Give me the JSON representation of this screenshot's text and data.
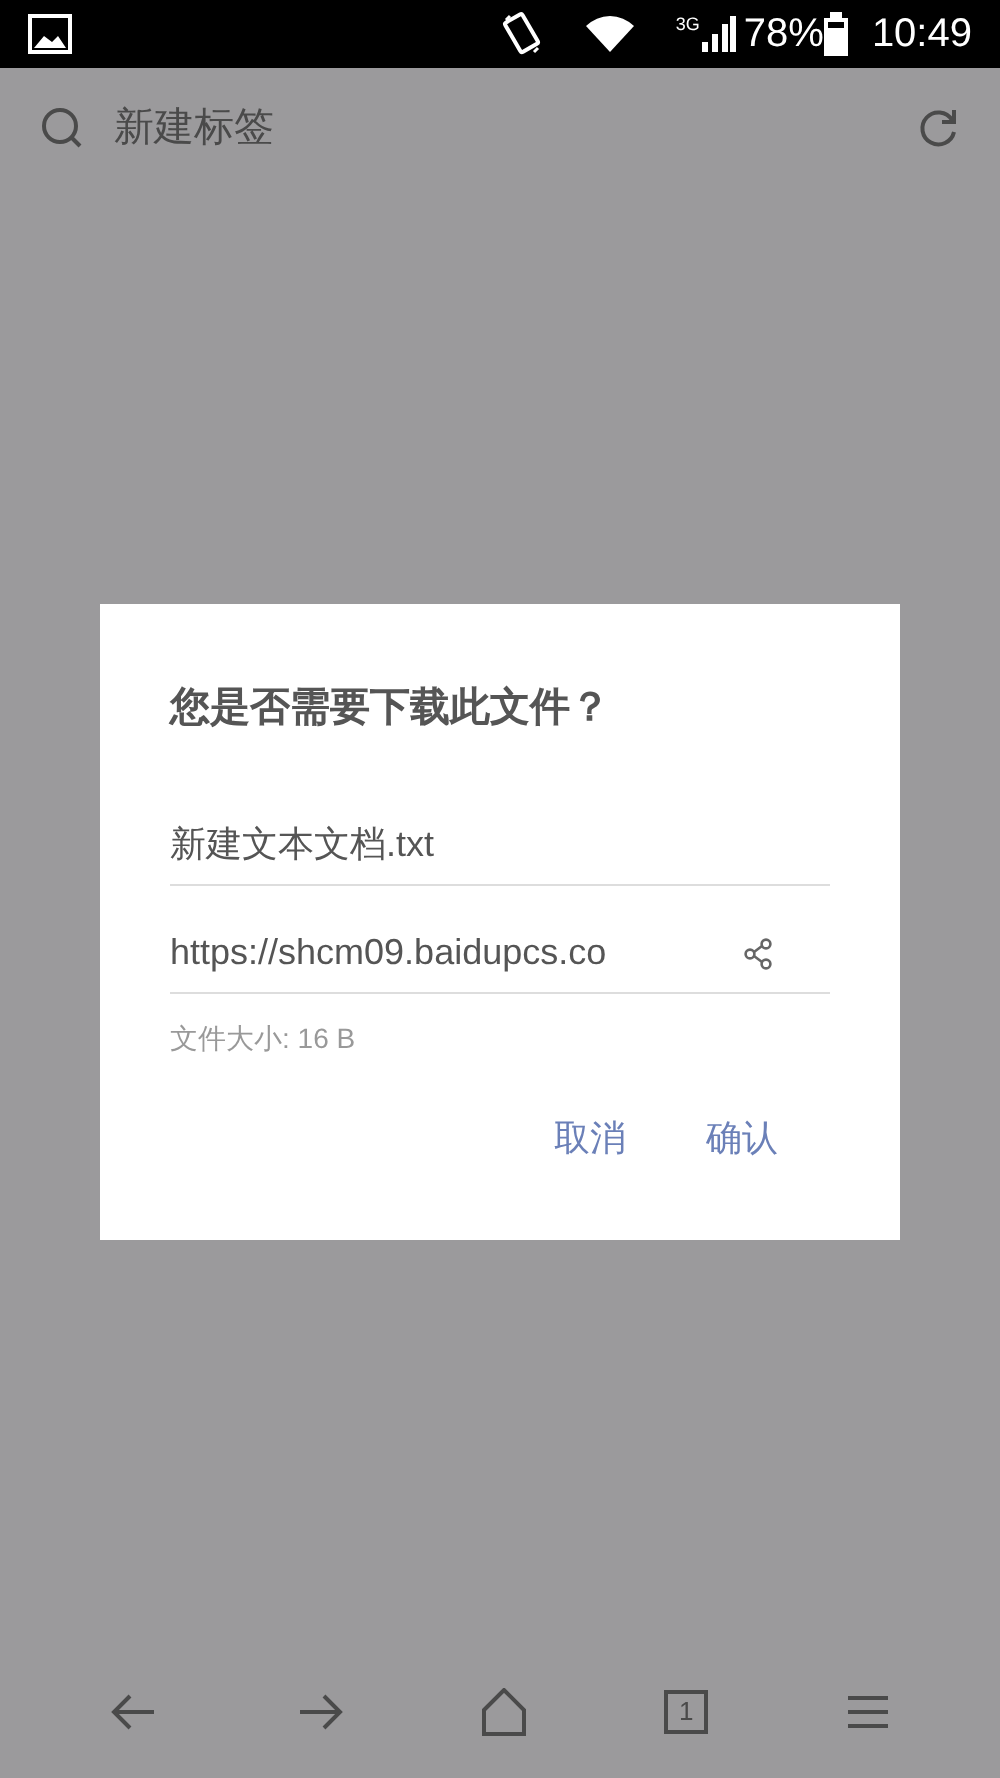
{
  "status_bar": {
    "network": "3G",
    "battery": "78%",
    "time": "10:49"
  },
  "address_bar": {
    "placeholder": "新建标签"
  },
  "dialog": {
    "title": "您是否需要下载此文件？",
    "file_name": "新建文本文档.txt",
    "url": "https://shcm09.baidupcs.co",
    "file_size": "文件大小: 16 B",
    "buttons": [
      "取消",
      "确认"
    ]
  },
  "bottom_bar": {
    "tab_count": "1"
  }
}
